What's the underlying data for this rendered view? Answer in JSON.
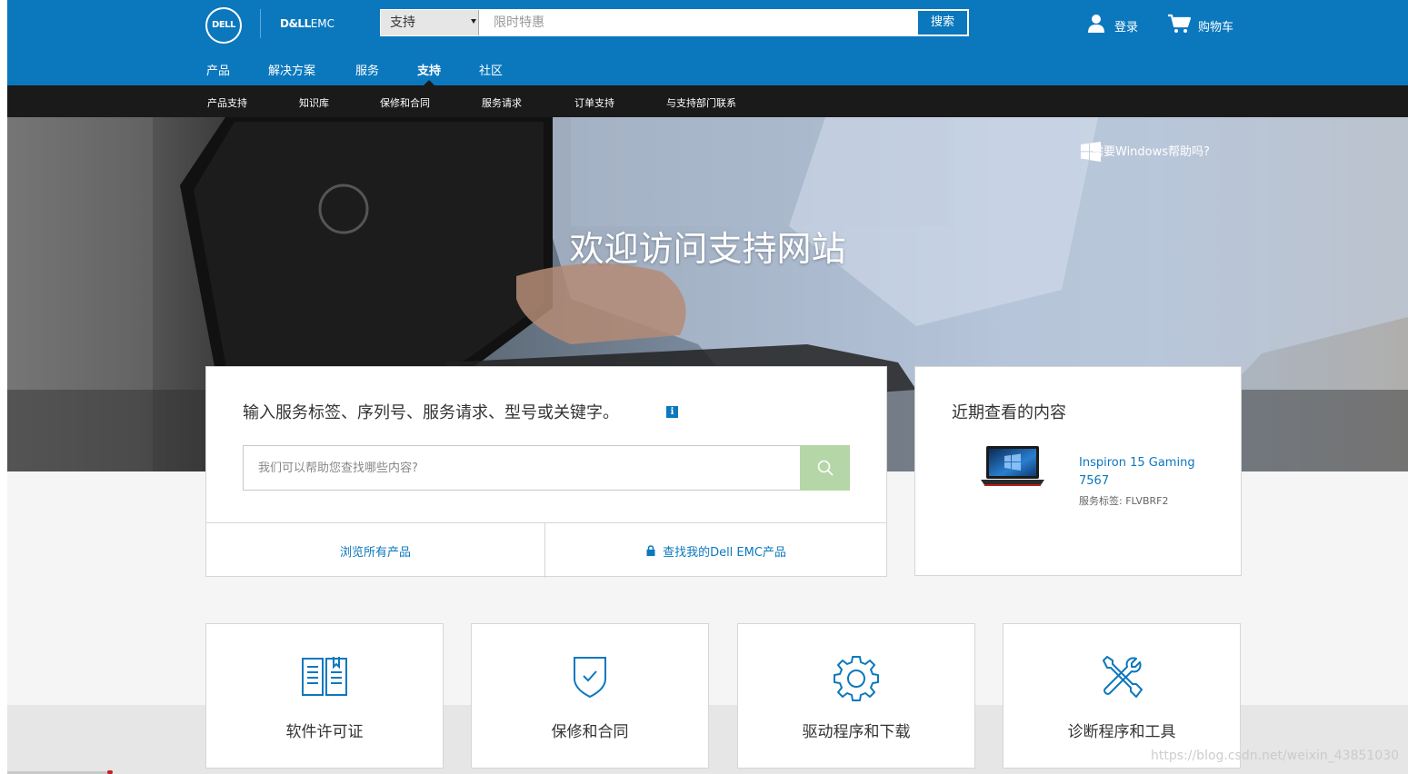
{
  "header": {
    "logo_text": "DELL",
    "brand_text_bold": "D&LL",
    "brand_text_rest": "EMC",
    "search_scope": "支持",
    "search_placeholder": "限时特惠",
    "search_button": "搜索",
    "signin_label": "登录",
    "cart_label": "购物车"
  },
  "main_nav": {
    "items": [
      {
        "label": "产品"
      },
      {
        "label": "解决方案"
      },
      {
        "label": "服务"
      },
      {
        "label": "支持",
        "active": true
      },
      {
        "label": "社区"
      }
    ]
  },
  "sub_nav": {
    "items": [
      {
        "label": "产品支持"
      },
      {
        "label": "知识库"
      },
      {
        "label": "保修和合同"
      },
      {
        "label": "服务请求"
      },
      {
        "label": "订单支持"
      },
      {
        "label": "与支持部门联系"
      }
    ]
  },
  "hero": {
    "title": "欢迎访问支持网站",
    "windows_help": "需要Windows帮助吗?"
  },
  "support_search": {
    "title": "输入服务标签、序列号、服务请求、型号或关键字。",
    "info_icon": "i",
    "placeholder": "我们可以帮助您查找哪些内容?",
    "browse_all": "浏览所有产品",
    "find_my_products": "查找我的Dell EMC产品"
  },
  "recently_viewed": {
    "title": "近期查看的内容",
    "item_name": "Inspiron 15 Gaming 7567",
    "service_tag": "服务标签: FLVBRF2"
  },
  "tiles": [
    {
      "label": "软件许可证",
      "icon": "book-icon"
    },
    {
      "label": "保修和合同",
      "icon": "shield-check-icon"
    },
    {
      "label": "驱动程序和下载",
      "icon": "gear-icon"
    },
    {
      "label": "诊断程序和工具",
      "icon": "tools-icon"
    }
  ],
  "watermark": "https://blog.csdn.net/weixin_43851030",
  "colors": {
    "brand_blue": "#0b78be",
    "subnav_black": "#1a1a1a",
    "search_green": "#b5d6a6"
  }
}
